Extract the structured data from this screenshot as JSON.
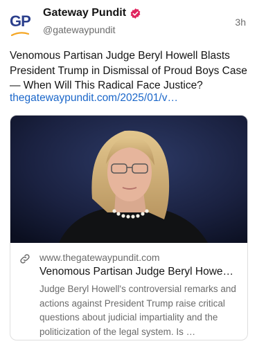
{
  "post": {
    "author_name": "Gateway Pundit",
    "author_handle": "@gatewaypundit",
    "avatar_text": "GP",
    "timestamp": "3h",
    "text": "Venomous Partisan Judge Beryl Howell Blasts President Trump in Dismissal of Proud Boys Case — When Will This Radical Face Justice?",
    "link_text": "thegatewaypundit.com/2025/01/v…"
  },
  "card": {
    "domain": "www.thegatewaypundit.com",
    "title": "Venomous Partisan Judge Beryl Howe…",
    "description": "Judge Beryl Howell's controversial remarks and actions against President Trump raise critical questions about judicial impartiality and the politicization of the legal system. Is …"
  },
  "icons": {
    "verified": "verified-badge-icon",
    "link": "link-icon"
  },
  "colors": {
    "brand_blue": "#2b3f8c",
    "brand_orange": "#f5a623",
    "verified_red": "#e0245e",
    "link_blue": "#1a66c9",
    "muted": "#6b6b6b"
  }
}
